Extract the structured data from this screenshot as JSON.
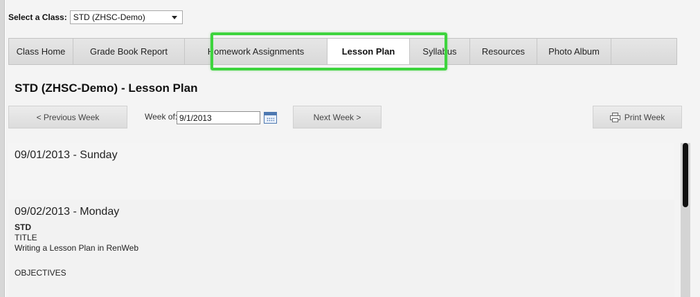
{
  "class_selector": {
    "label": "Select a Class:",
    "selected": "STD (ZHSC-Demo)"
  },
  "tabs": [
    {
      "label": "Class Home",
      "active": false
    },
    {
      "label": "Grade Book Report",
      "active": false
    },
    {
      "label": "Homework Assignments",
      "active": false
    },
    {
      "label": "Lesson Plan",
      "active": true
    },
    {
      "label": "Syllabus",
      "active": false
    },
    {
      "label": "Resources",
      "active": false
    },
    {
      "label": "Photo Album",
      "active": false
    }
  ],
  "page_title": "STD (ZHSC-Demo) - Lesson Plan",
  "week_nav": {
    "prev_label": "< Previous Week",
    "week_of_label": "Week of:",
    "week_value": "9/1/2013",
    "next_label": "Next Week >",
    "print_label": "Print Week"
  },
  "days": [
    {
      "heading": "09/01/2013 - Sunday"
    },
    {
      "heading": "09/02/2013 - Monday",
      "subject": "STD",
      "title_label": "TITLE",
      "title_value": "Writing a Lesson Plan in RenWeb",
      "objectives_label": "OBJECTIVES"
    }
  ],
  "colors": {
    "highlight": "#3ed43e",
    "calendar_icon": "#4d78b0"
  }
}
